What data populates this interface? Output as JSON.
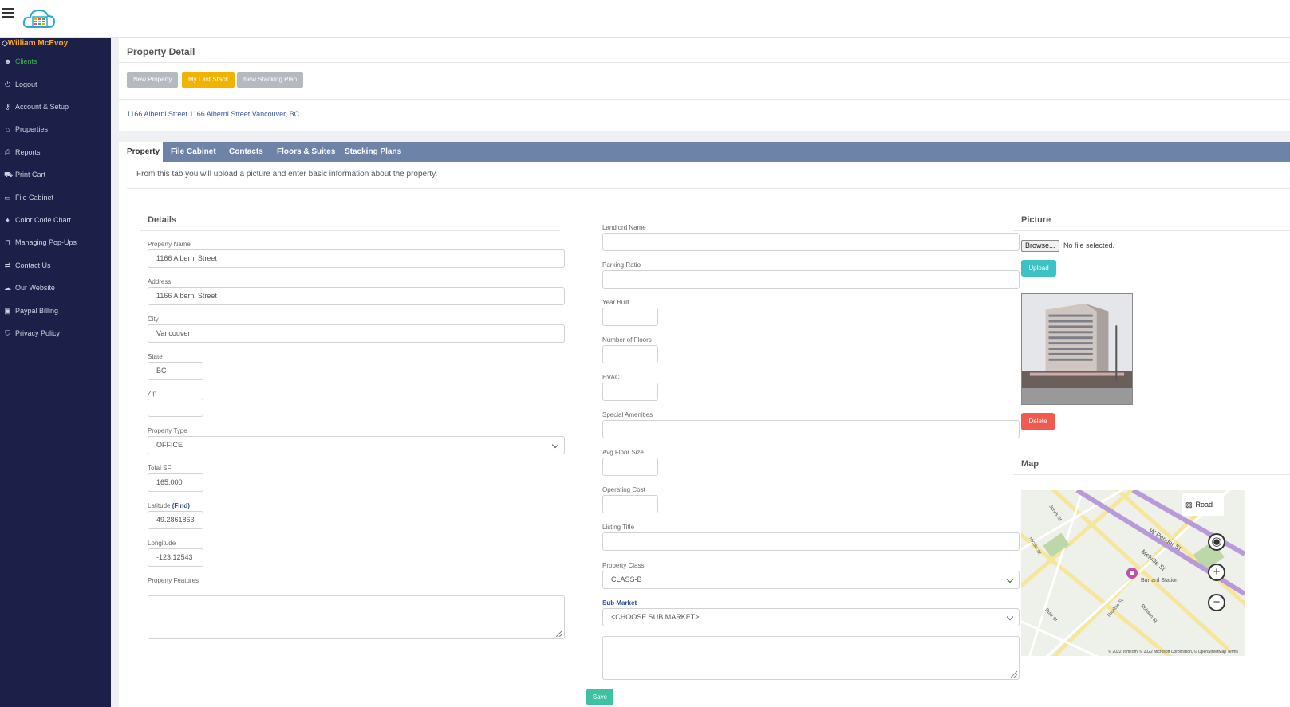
{
  "user": {
    "name": "William McEvoy"
  },
  "sidebar": {
    "items": [
      {
        "label": "Clients",
        "icon": "users-icon"
      },
      {
        "label": "Logout",
        "icon": "power-icon"
      },
      {
        "label": "Account & Setup",
        "icon": "key-icon"
      },
      {
        "label": "Properties",
        "icon": "home-icon"
      },
      {
        "label": "Reports",
        "icon": "print-icon"
      },
      {
        "label": "Print Cart",
        "icon": "cart-icon"
      },
      {
        "label": "File Cabinet",
        "icon": "folder-icon"
      },
      {
        "label": "Color Code Chart",
        "icon": "drop-icon"
      },
      {
        "label": "Managing Pop-Ups",
        "icon": "lock-icon"
      },
      {
        "label": "Contact Us",
        "icon": "exchange-icon"
      },
      {
        "label": "Our Website",
        "icon": "cloud-icon"
      },
      {
        "label": "Paypal Billing",
        "icon": "money-icon"
      },
      {
        "label": "Privacy Policy",
        "icon": "shield-icon"
      }
    ]
  },
  "page": {
    "title": "Property Detail",
    "buttons": {
      "new_property": "New Property",
      "my_last_stack": "My Last Stack",
      "new_stacking_plan": "New Stacking Plan"
    },
    "address_line": "1166 Alberni Street 1166 Alberni Street Vancouver, BC",
    "intro": "From this tab you will upload a picture and enter basic information about the property."
  },
  "tabs": [
    "Property",
    "File Cabinet",
    "Contacts",
    "Floors & Suites",
    "Stacking Plans"
  ],
  "details": {
    "title": "Details",
    "property_name": {
      "label": "Property Name",
      "value": "1166 Alberni Street"
    },
    "address": {
      "label": "Address",
      "value": "1166 Alberni Street"
    },
    "city": {
      "label": "City",
      "value": "Vancouver"
    },
    "state": {
      "label": "State",
      "value": "BC"
    },
    "zip": {
      "label": "Zip",
      "value": ""
    },
    "property_type": {
      "label": "Property Type",
      "value": "OFFICE"
    },
    "total_sf": {
      "label": "Total SF",
      "value": "165,000"
    },
    "latitude": {
      "label": "Latitude",
      "find": "(Find)",
      "value": "49.2861863"
    },
    "longitude": {
      "label": "Longitude",
      "value": "-123.12543"
    },
    "features": {
      "label": "Property Features"
    }
  },
  "extra": {
    "landlord_name": "Landlord Name",
    "parking_ratio": "Parking Ratio",
    "year_built": "Year Built",
    "number_of_floors": "Number of Floors",
    "hvac": "HVAC",
    "special_amenities": "Special Amenities",
    "avg_floor_size": "Avg.Floor Size",
    "operating_cost": "Operating Cost",
    "listing_title": "Listing Title",
    "property_class": {
      "label": "Property Class",
      "value": "CLASS-B"
    },
    "sub_market": {
      "label": "Sub Market",
      "value": "<CHOOSE SUB MARKET>"
    },
    "save": "Save"
  },
  "picture": {
    "title": "Picture",
    "browse": "Browse...",
    "no_file": "No file selected.",
    "upload": "Upload",
    "delete": "Delete"
  },
  "map": {
    "title": "Map",
    "road": "Road",
    "streets": [
      "W Pender St",
      "Melville St",
      "Burrard Station",
      "Robson St",
      "Thurlow St",
      "Bute St",
      "Nicola St",
      "Jervis St"
    ],
    "footer": "© 2022 TomTom, © 2022 Microsoft Corporation, © OpenStreetMap  Terms"
  },
  "colors": {
    "sidebar": "#1c2048",
    "tabbar": "#6e83a8",
    "accent_yellow": "#f0b400",
    "upload": "#3cc2c4",
    "delete": "#f05a50"
  }
}
